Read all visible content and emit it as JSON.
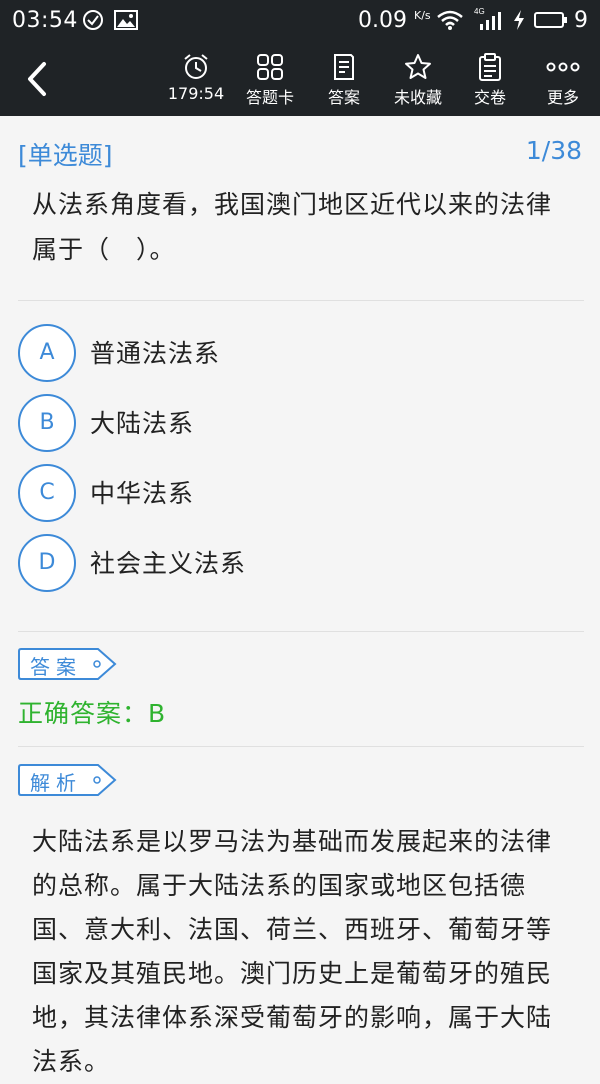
{
  "status_bar": {
    "time": "03:54",
    "net_speed": "0.09",
    "net_unit": "K/s",
    "network": "4G",
    "battery_level": "9"
  },
  "toolbar": {
    "timer": "179:54",
    "answer_card": "答题卡",
    "answer": "答案",
    "favorite": "未收藏",
    "submit": "交卷",
    "more": "更多"
  },
  "question": {
    "type": "[单选题]",
    "number": "1/38",
    "stem": "从法系角度看，我国澳门地区近代以来的法律属于（　）。",
    "options": [
      {
        "letter": "A",
        "text": "普通法法系"
      },
      {
        "letter": "B",
        "text": "大陆法系"
      },
      {
        "letter": "C",
        "text": "中华法系"
      },
      {
        "letter": "D",
        "text": "社会主义法系"
      }
    ]
  },
  "answer_section": {
    "tag": "答案",
    "correct_answer": "正确答案：B"
  },
  "analysis_section": {
    "tag": "解析",
    "text": "大陆法系是以罗马法为基础而发展起来的法律的总称。属于大陆法系的国家或地区包括德国、意大利、法国、荷兰、西班牙、葡萄牙等国家及其殖民地。澳门历史上是葡萄牙的殖民地，其法律体系深受葡萄牙的影响，属于大陆法系。"
  },
  "colors": {
    "accent": "#3d8ad8",
    "correct": "#2fb32f",
    "toolbar_bg": "#1f2326"
  }
}
